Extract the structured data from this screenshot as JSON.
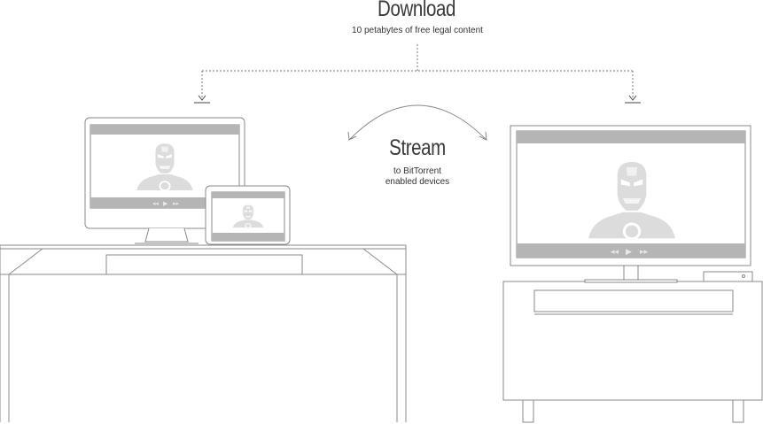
{
  "download": {
    "title": "Download",
    "subtitle": "10 petabytes of free legal content"
  },
  "stream": {
    "title": "Stream",
    "subtitle_line1": "to BitTorrent",
    "subtitle_line2": "enabled devices"
  },
  "player_controls": {
    "rewind": "◂◂",
    "play": "▶",
    "forward": "▸▸"
  },
  "colors": {
    "line": "#9a9a9a",
    "screen_bar": "#b5b5b5",
    "silhouette": "#dcdcdc",
    "text": "#3a3a3a"
  },
  "icons": [
    "arrow-down-icon",
    "curved-double-arrow-icon",
    "iron-man-silhouette-icon"
  ]
}
